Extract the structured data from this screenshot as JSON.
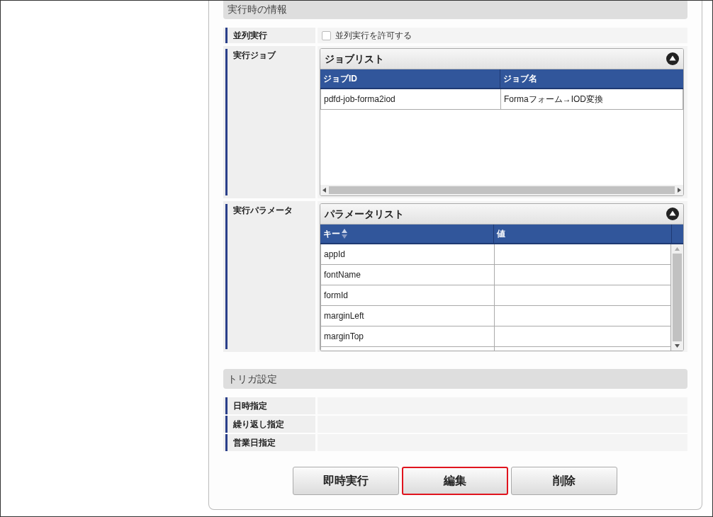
{
  "runtime_section": {
    "title": "実行時の情報",
    "parallel": {
      "label": "並列実行",
      "checkbox": {
        "label": "並列実行を許可する",
        "checked": false
      }
    },
    "job": {
      "label": "実行ジョブ",
      "grid": {
        "title": "ジョブリスト",
        "columns": [
          {
            "label": "ジョブID",
            "sortable": false
          },
          {
            "label": "ジョブ名",
            "sortable": false
          }
        ],
        "rows": [
          [
            "pdfd-job-forma2iod",
            "Formaフォーム→IOD変換"
          ]
        ]
      }
    },
    "params": {
      "label": "実行パラメータ",
      "grid": {
        "title": "パラメータリスト",
        "columns": [
          {
            "label": "キー",
            "sortable": true
          },
          {
            "label": "値",
            "sortable": false
          }
        ],
        "rows": [
          [
            "appId",
            ""
          ],
          [
            "fontName",
            ""
          ],
          [
            "formId",
            ""
          ],
          [
            "marginLeft",
            ""
          ],
          [
            "marginTop",
            ""
          ]
        ]
      }
    }
  },
  "trigger_section": {
    "title": "トリガ設定",
    "rows": [
      {
        "label": "日時指定"
      },
      {
        "label": "繰り返し指定"
      },
      {
        "label": "営業日指定"
      }
    ]
  },
  "buttons": [
    {
      "label": "即時実行",
      "highlighted": false
    },
    {
      "label": "編集",
      "highlighted": true
    },
    {
      "label": "削除",
      "highlighted": false
    }
  ]
}
